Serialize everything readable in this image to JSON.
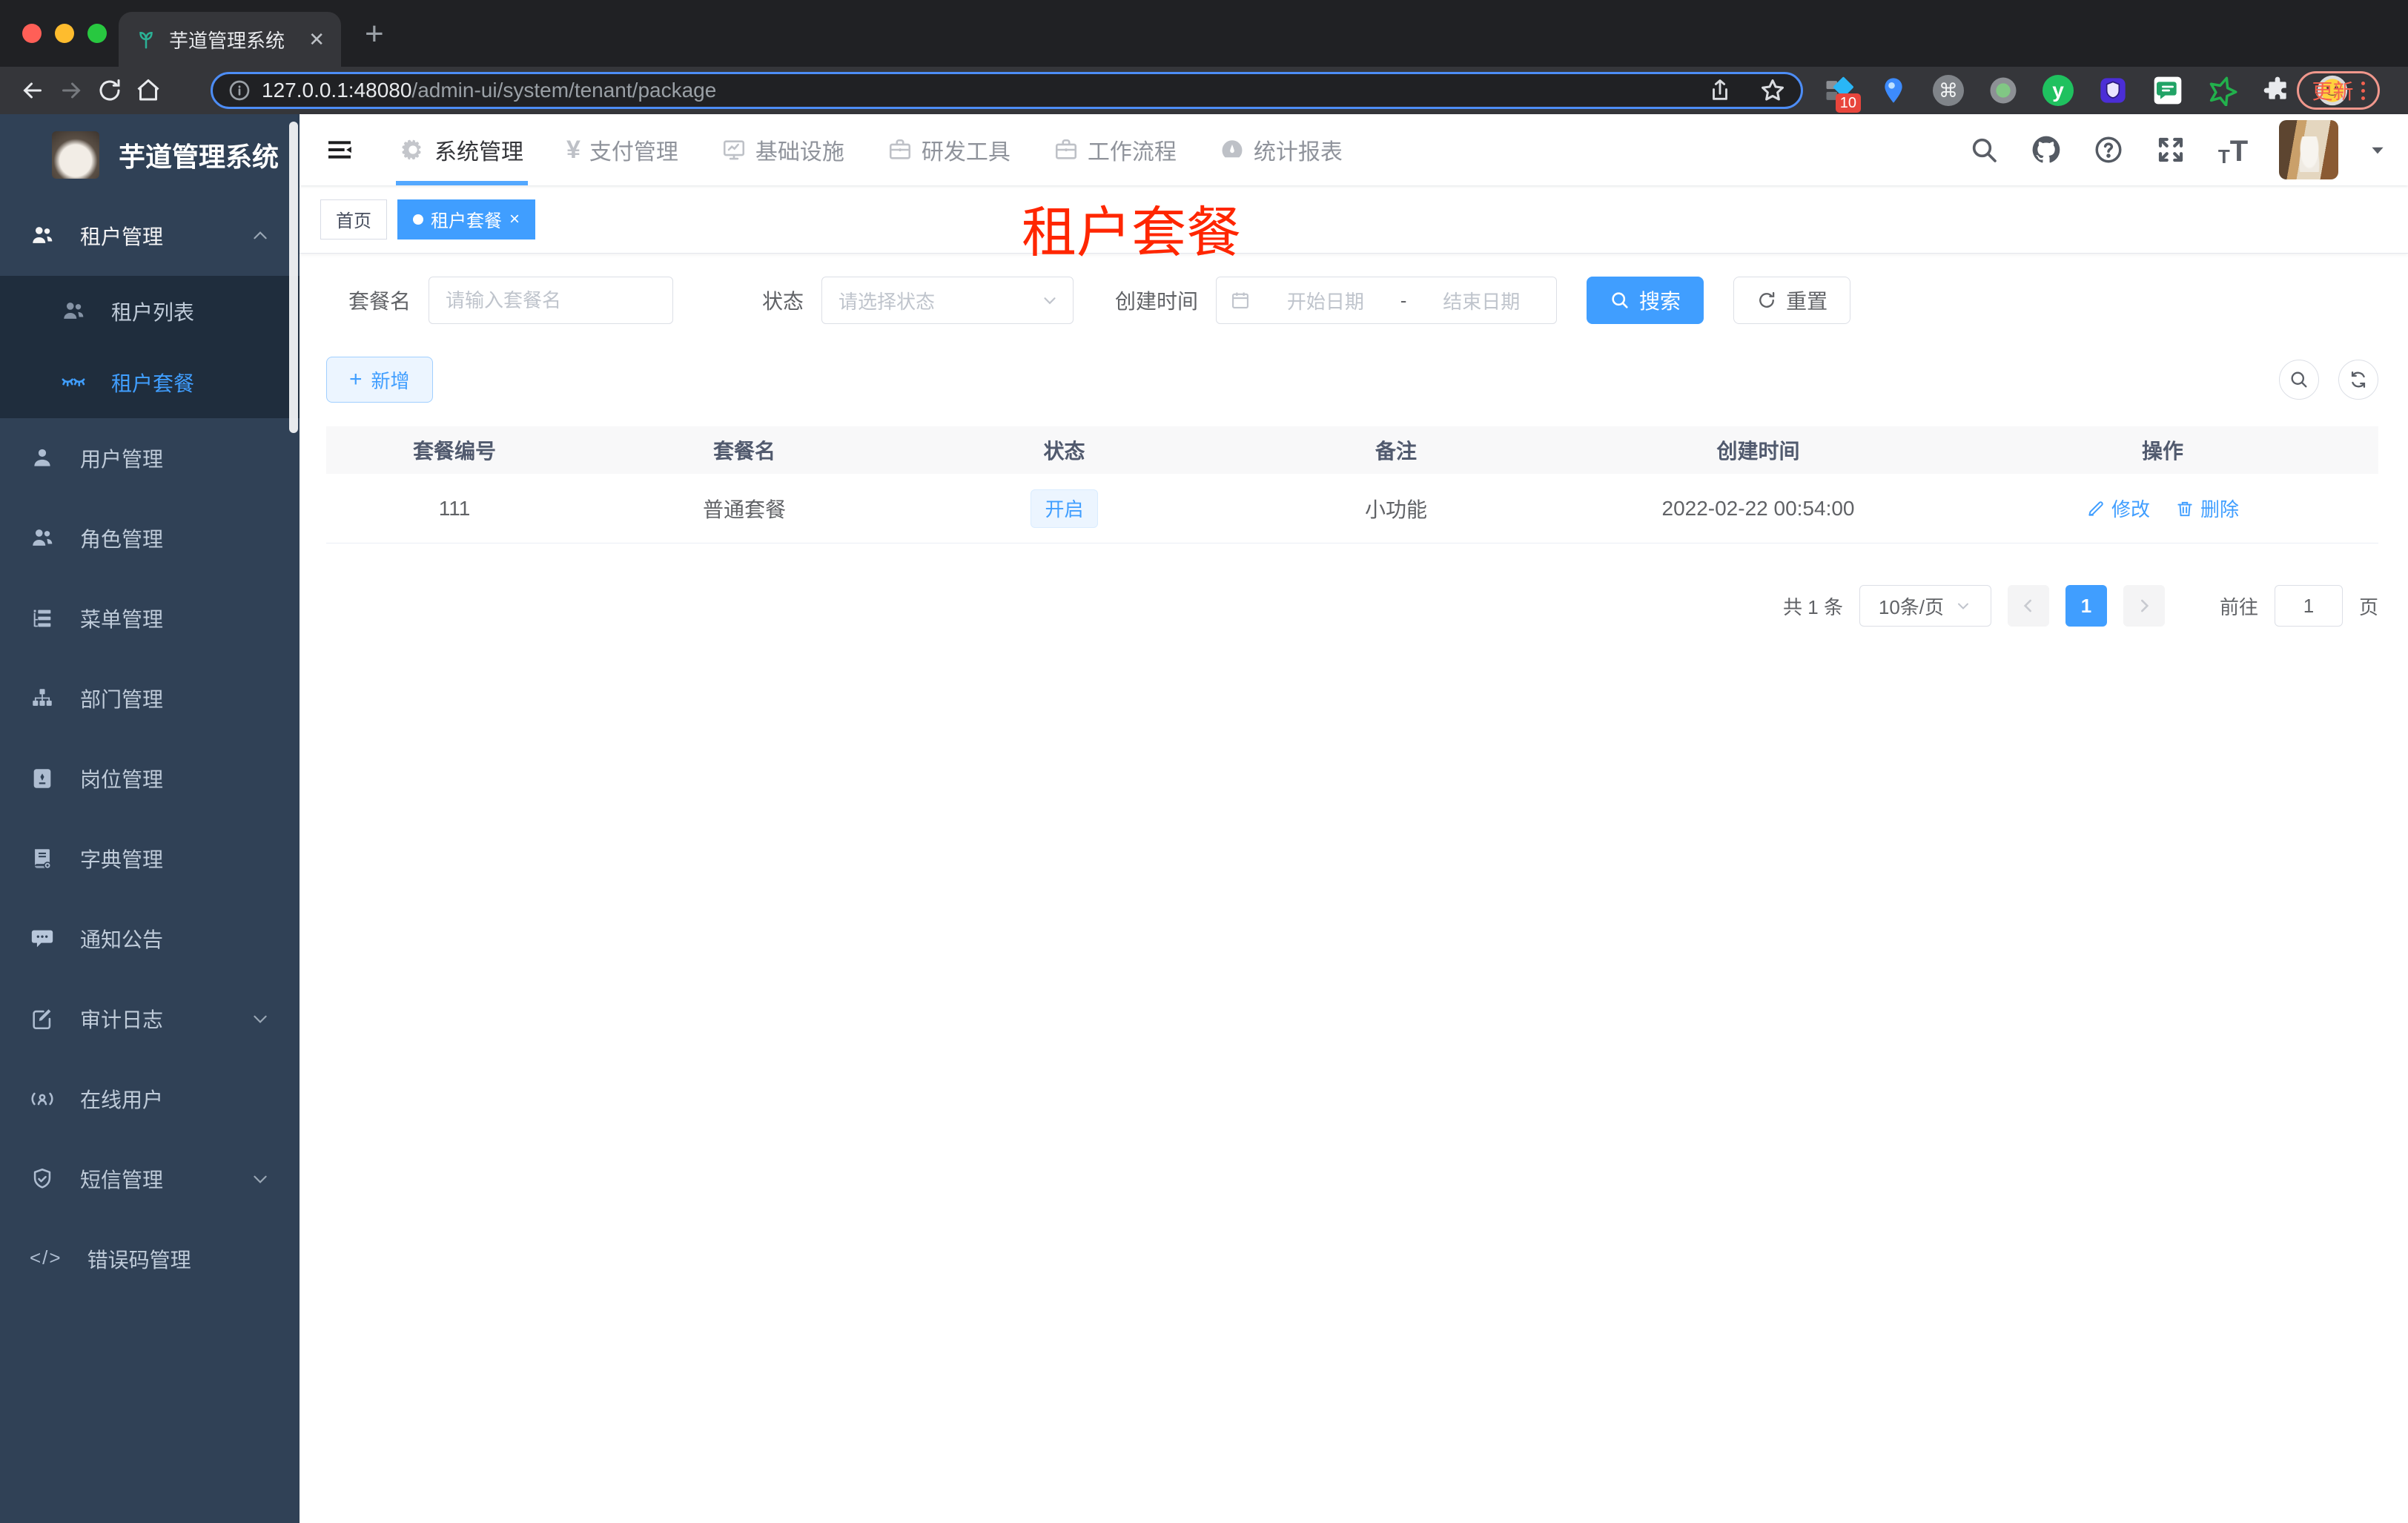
{
  "colors": {
    "primary": "#409eff",
    "sidebar_bg": "#304156",
    "submenu_bg": "#1f2d3d",
    "overlay_red": "#ff2600"
  },
  "browser": {
    "tab_title": "芋道管理系统",
    "close_glyph": "✕",
    "new_tab_glyph": "+",
    "url_host": "127.0.0.1:48080",
    "url_path": "/admin-ui/system/tenant/package",
    "extension_badge": "10",
    "cmd_glyph": "⌘",
    "y_glyph": "y",
    "update_label": "更新"
  },
  "sidebar": {
    "logo_title": "芋道管理系统",
    "tenant_root": "租户管理",
    "tenant_list": "租户列表",
    "tenant_package": "租户套餐",
    "items": [
      {
        "label": "用户管理"
      },
      {
        "label": "角色管理"
      },
      {
        "label": "菜单管理"
      },
      {
        "label": "部门管理"
      },
      {
        "label": "岗位管理"
      },
      {
        "label": "字典管理"
      },
      {
        "label": "通知公告"
      },
      {
        "label": "审计日志"
      },
      {
        "label": "在线用户"
      },
      {
        "label": "短信管理"
      },
      {
        "label": "错误码管理"
      }
    ],
    "code_glyph": "</>"
  },
  "nav": {
    "yen_glyph": "¥",
    "items": [
      {
        "label": "系统管理"
      },
      {
        "label": "支付管理"
      },
      {
        "label": "基础设施"
      },
      {
        "label": "研发工具"
      },
      {
        "label": "工作流程"
      },
      {
        "label": "统计报表"
      }
    ]
  },
  "tags": {
    "home": "首页",
    "active": "租户套餐",
    "close_glyph": "×"
  },
  "overlay_title": "租户套餐",
  "filters": {
    "name_label": "套餐名",
    "name_placeholder": "请输入套餐名",
    "status_label": "状态",
    "status_placeholder": "请选择状态",
    "date_label": "创建时间",
    "date_start": "开始日期",
    "date_separator": "-",
    "date_end": "结束日期",
    "search_label": "搜索",
    "reset_label": "重置"
  },
  "toolbar": {
    "add_label": "新增",
    "plus_glyph": "+"
  },
  "table": {
    "headers": [
      "套餐编号",
      "套餐名",
      "状态",
      "备注",
      "创建时间",
      "操作"
    ],
    "row": {
      "id": "111",
      "name": "普通套餐",
      "status": "开启",
      "remark": "小功能",
      "created": "2022-02-22 00:54:00"
    },
    "edit_label": "修改",
    "delete_label": "删除"
  },
  "pagination": {
    "total": "共 1 条",
    "page_size": "10条/页",
    "current_page": "1",
    "goto_label": "前往",
    "goto_value": "1",
    "page_unit": "页"
  }
}
